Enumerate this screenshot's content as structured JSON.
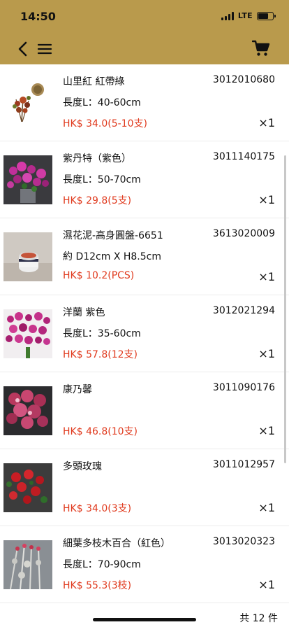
{
  "status_bar": {
    "time": "14:50",
    "network": "LTE",
    "battery_level": 0.7
  },
  "nav": {
    "back_icon": "chevron-left-icon",
    "menu_icon": "hamburger-menu-icon",
    "cart_icon": "shopping-cart-icon"
  },
  "items": [
    {
      "name": "山里紅 紅帶綠",
      "code": "3012010680",
      "size": "長度L：40-60cm",
      "price": "HK$ 34.0(5-10支)",
      "qty": "×1"
    },
    {
      "name": "紫丹特（紫色）",
      "code": "3011140175",
      "size": "長度L：50-70cm",
      "price": "HK$ 29.8(5支)",
      "qty": "×1"
    },
    {
      "name": "濕花泥-高身圓盤-6651",
      "code": "3613020009",
      "size": "約 D12cm X H8.5cm",
      "price": "HK$ 10.2(PCS)",
      "qty": "×1"
    },
    {
      "name": "洋蘭 紫色",
      "code": "3012021294",
      "size": "長度L：35-60cm",
      "price": "HK$ 57.8(12支)",
      "qty": "×1"
    },
    {
      "name": "康乃馨",
      "code": "3011090176",
      "size": "",
      "price": "HK$ 46.8(10支)",
      "qty": "×1"
    },
    {
      "name": "多頭玫瑰",
      "code": "3011012957",
      "size": "",
      "price": "HK$ 34.0(3支)",
      "qty": "×1"
    },
    {
      "name": "細葉多枝木百合（紅色）",
      "code": "3013020323",
      "size": "長度L：70-90cm",
      "price": "HK$ 55.3(3枝)",
      "qty": "×1"
    }
  ],
  "footer": {
    "total": "共 12 件"
  },
  "colors": {
    "header": "#b99a4c",
    "price": "#e03a1e"
  }
}
